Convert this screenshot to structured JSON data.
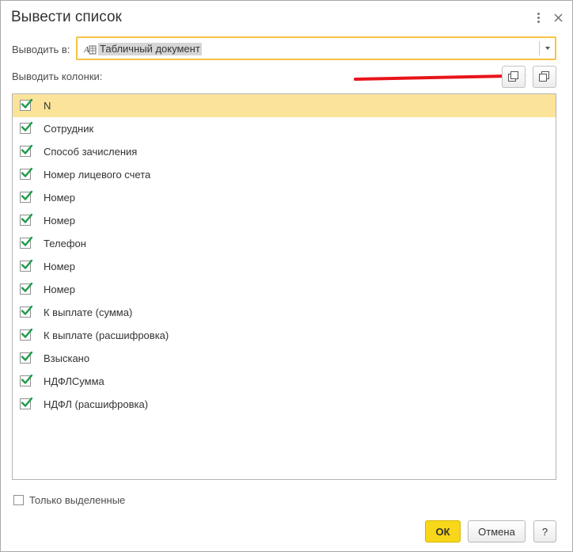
{
  "dialog": {
    "title": "Вывести список"
  },
  "output": {
    "label": "Выводить в:",
    "value": "Табличный документ"
  },
  "columns": {
    "label": "Выводить колонки:",
    "items": [
      {
        "label": "N",
        "checked": true,
        "selected": true
      },
      {
        "label": "Сотрудник",
        "checked": true
      },
      {
        "label": "Способ зачисления",
        "checked": true
      },
      {
        "label": "Номер лицевого счета",
        "checked": true
      },
      {
        "label": "Номер",
        "checked": true
      },
      {
        "label": "Номер",
        "checked": true
      },
      {
        "label": "Телефон",
        "checked": true
      },
      {
        "label": "Номер",
        "checked": true
      },
      {
        "label": "Номер",
        "checked": true
      },
      {
        "label": "К выплате (сумма)",
        "checked": true
      },
      {
        "label": "К выплате (расшифровка)",
        "checked": true
      },
      {
        "label": "Взыскано",
        "checked": true
      },
      {
        "label": "НДФЛСумма",
        "checked": true
      },
      {
        "label": "НДФЛ (расшифровка)",
        "checked": true
      }
    ]
  },
  "options": {
    "only_selected_label": "Только выделенные",
    "only_selected_checked": false
  },
  "footer": {
    "ok_label": "ОК",
    "cancel_label": "Отмена",
    "help_label": "?"
  },
  "colors": {
    "accent": "#f8d71a",
    "selection": "#fbe49a",
    "check": "#1e9b4a",
    "annotation_arrow": "#e8141a"
  }
}
